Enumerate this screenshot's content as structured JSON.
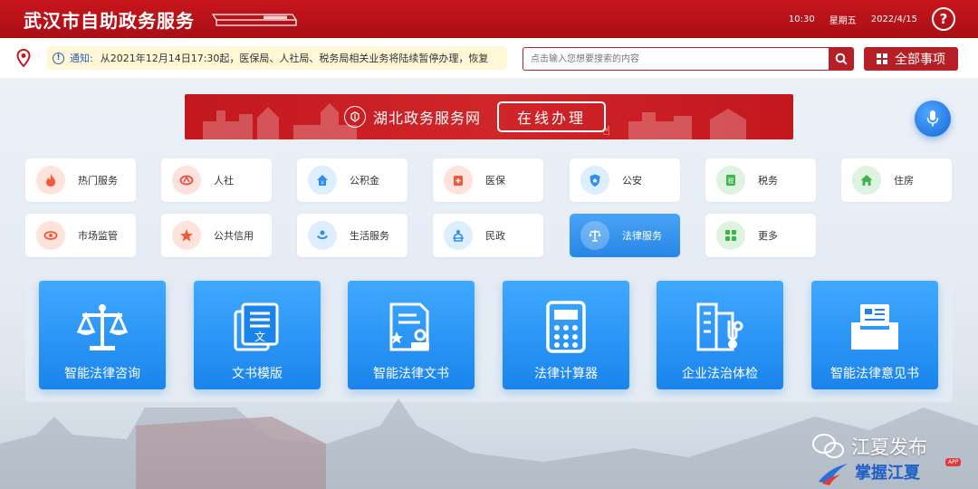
{
  "header": {
    "title": "武汉市自助政务服务",
    "time": "10:30",
    "weekday": "星期五",
    "date": "2022/4/15",
    "help_label": "?"
  },
  "notice": {
    "label": "通知:",
    "text": "从2021年12月14日17:30起，医保局、人社局、税务局相关业务将陆续暂停办理，恢复"
  },
  "search": {
    "placeholder": "点击输入您想要搜索的内容"
  },
  "all_items_label": "全部事项",
  "banner": {
    "title": "湖北政务服务网",
    "button": "在线办理"
  },
  "categories": [
    {
      "label": "热门服务",
      "icon": "fire-icon",
      "color": "#f05a3c"
    },
    {
      "label": "人社",
      "icon": "ren-she-icon",
      "color": "#e84a3a"
    },
    {
      "label": "公积金",
      "icon": "house-fund-icon",
      "color": "#2f8ff0"
    },
    {
      "label": "医保",
      "icon": "medical-icon",
      "color": "#f05a3c"
    },
    {
      "label": "公安",
      "icon": "police-shield-icon",
      "color": "#2f8ff0"
    },
    {
      "label": "税务",
      "icon": "tax-icon",
      "color": "#3cb54a"
    },
    {
      "label": "住房",
      "icon": "home-icon",
      "color": "#3cb54a"
    },
    {
      "label": "市场监管",
      "icon": "eye-icon",
      "color": "#f05a3c"
    },
    {
      "label": "公共信用",
      "icon": "star-icon",
      "color": "#f05a3c"
    },
    {
      "label": "生活服务",
      "icon": "hands-icon",
      "color": "#2f8ff0"
    },
    {
      "label": "民政",
      "icon": "civil-affairs-icon",
      "color": "#2f8ff0"
    },
    {
      "label": "法律服务",
      "icon": "scale-icon",
      "color": "#ffffff",
      "active": true
    },
    {
      "label": "更多",
      "icon": "more-grid-icon",
      "color": "#3cb54a"
    }
  ],
  "services": [
    {
      "label": "智能法律咨询",
      "icon": "scale-icon"
    },
    {
      "label": "文书模版",
      "icon": "document-template-icon"
    },
    {
      "label": "智能法律文书",
      "icon": "legal-document-stamp-icon"
    },
    {
      "label": "法律计算器",
      "icon": "calculator-icon"
    },
    {
      "label": "企业法治体检",
      "icon": "building-checkup-icon"
    },
    {
      "label": "智能法律意见书",
      "icon": "opinion-letter-icon"
    }
  ],
  "watermark": {
    "line1": "江夏发布",
    "line2": "掌握江夏",
    "app": "APP"
  }
}
